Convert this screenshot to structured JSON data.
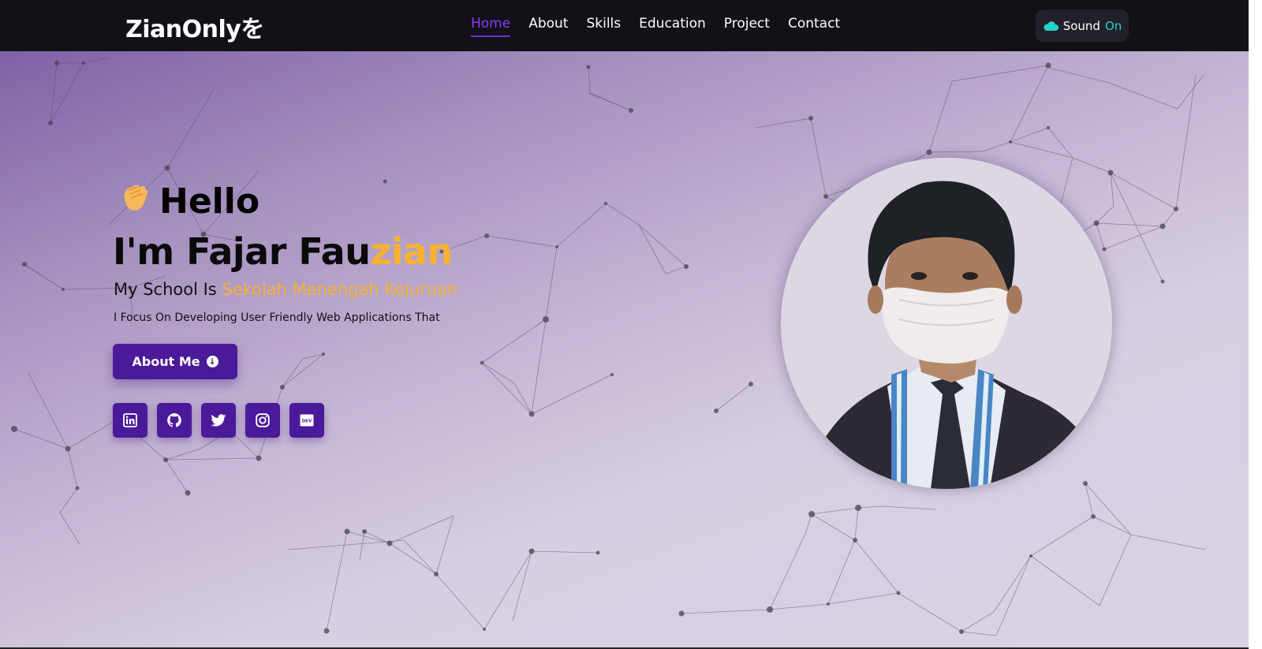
{
  "brand": {
    "name": "ZianOnlyを"
  },
  "nav": {
    "items": [
      {
        "label": "Home",
        "active": true
      },
      {
        "label": "About",
        "active": false
      },
      {
        "label": "Skills",
        "active": false
      },
      {
        "label": "Education",
        "active": false
      },
      {
        "label": "Project",
        "active": false
      },
      {
        "label": "Contact",
        "active": false
      }
    ],
    "sound": {
      "label": "Sound",
      "state": "On",
      "icon": "cloud-icon"
    }
  },
  "hero": {
    "greeting_icon": "waving-hand-icon",
    "greeting": "Hello",
    "name_prefix": "I'm Fajar Fau",
    "name_highlight": "zian",
    "school_prefix": "My School Is",
    "school_highlight": "Sekolah Menengah Kejuruan",
    "focus": "I Focus On Developing User Friendly Web Applications That",
    "about_button": {
      "label": "About Me",
      "icon": "arrow-down-circle-icon"
    },
    "socials": [
      {
        "name": "linkedin",
        "icon": "linkedin-icon"
      },
      {
        "name": "github",
        "icon": "github-icon"
      },
      {
        "name": "twitter",
        "icon": "twitter-icon"
      },
      {
        "name": "instagram",
        "icon": "instagram-icon"
      },
      {
        "name": "dev",
        "icon": "dev-icon",
        "text": "DEV"
      }
    ]
  },
  "colors": {
    "nav_bg": "#131118",
    "accent_purple": "#4a1a9a",
    "active_link": "#8c37ff",
    "highlight": "#f8b133",
    "sound_on": "#21d4c3"
  }
}
